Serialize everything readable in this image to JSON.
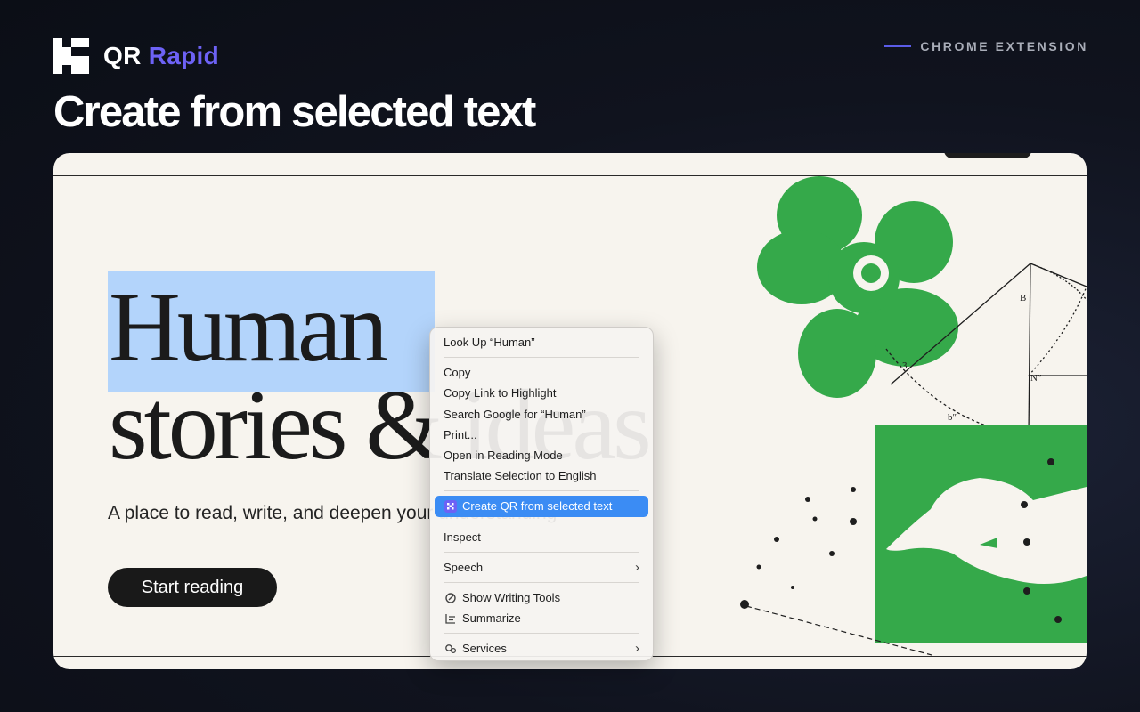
{
  "brand": {
    "name_primary": "QR",
    "name_accent": "Rapid",
    "accent_color": "#6d62f5"
  },
  "tag": {
    "label": "CHROME EXTENSION"
  },
  "headline": "Create from selected text",
  "page": {
    "hero_line1": "Human",
    "hero_line2": "stories & ideas",
    "tagline": "A place to read, write, and deepen your understanding",
    "cta_label": "Start reading",
    "selection_color": "#b3d4fb",
    "art_green": "#35a94a"
  },
  "context_menu": {
    "items": [
      {
        "label": "Look Up “Human”"
      },
      {
        "label": "Copy"
      },
      {
        "label": "Copy Link to Highlight"
      },
      {
        "label": "Search Google for “Human”"
      },
      {
        "label": "Print..."
      },
      {
        "label": "Open in Reading Mode"
      },
      {
        "label": "Translate Selection to English"
      },
      {
        "label": "Create QR from selected text",
        "icon": "qr-rapid-logo-icon",
        "highlighted": true
      },
      {
        "label": "Inspect"
      },
      {
        "label": "Speech",
        "submenu": true
      },
      {
        "label": "Show Writing Tools",
        "icon": "writing-tools-icon"
      },
      {
        "label": "Summarize",
        "icon": "summarize-icon"
      },
      {
        "label": "Services",
        "icon": "services-icon",
        "submenu": true
      }
    ],
    "highlight_color": "#3b8cf4"
  }
}
